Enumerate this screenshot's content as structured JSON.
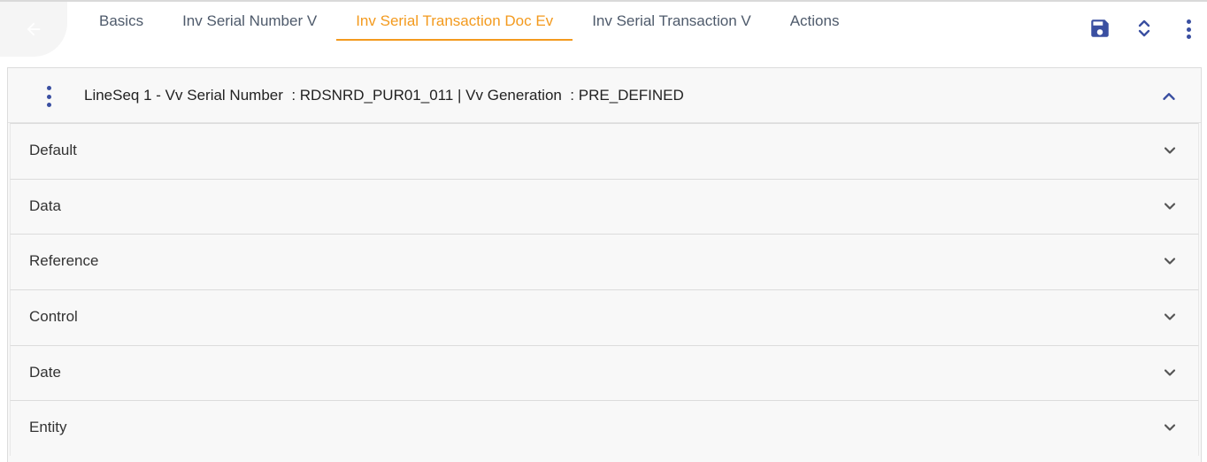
{
  "tabs": [
    {
      "label": "Basics",
      "active": false
    },
    {
      "label": "Inv Serial Number V",
      "active": false
    },
    {
      "label": "Inv Serial Transaction Doc Ev",
      "active": true
    },
    {
      "label": "Inv Serial Transaction V",
      "active": false
    },
    {
      "label": "Actions",
      "active": false
    }
  ],
  "panel": {
    "header": "LineSeq 1 - Vv Serial Number  : RDSNRD_PUR01_011 | Vv Generation  : PRE_DEFINED"
  },
  "sections": [
    {
      "label": "Default"
    },
    {
      "label": "Data"
    },
    {
      "label": "Reference"
    },
    {
      "label": "Control"
    },
    {
      "label": "Date"
    },
    {
      "label": "Entity"
    }
  ],
  "colors": {
    "accent": "#f39a1e",
    "icon_primary": "#3a4fa1",
    "tab_text": "#4e5a6b"
  },
  "icons": {
    "back": "arrow-left-icon",
    "save": "save-icon",
    "expand_collapse": "expand-collapse-icon",
    "more": "more-vertical-icon"
  }
}
